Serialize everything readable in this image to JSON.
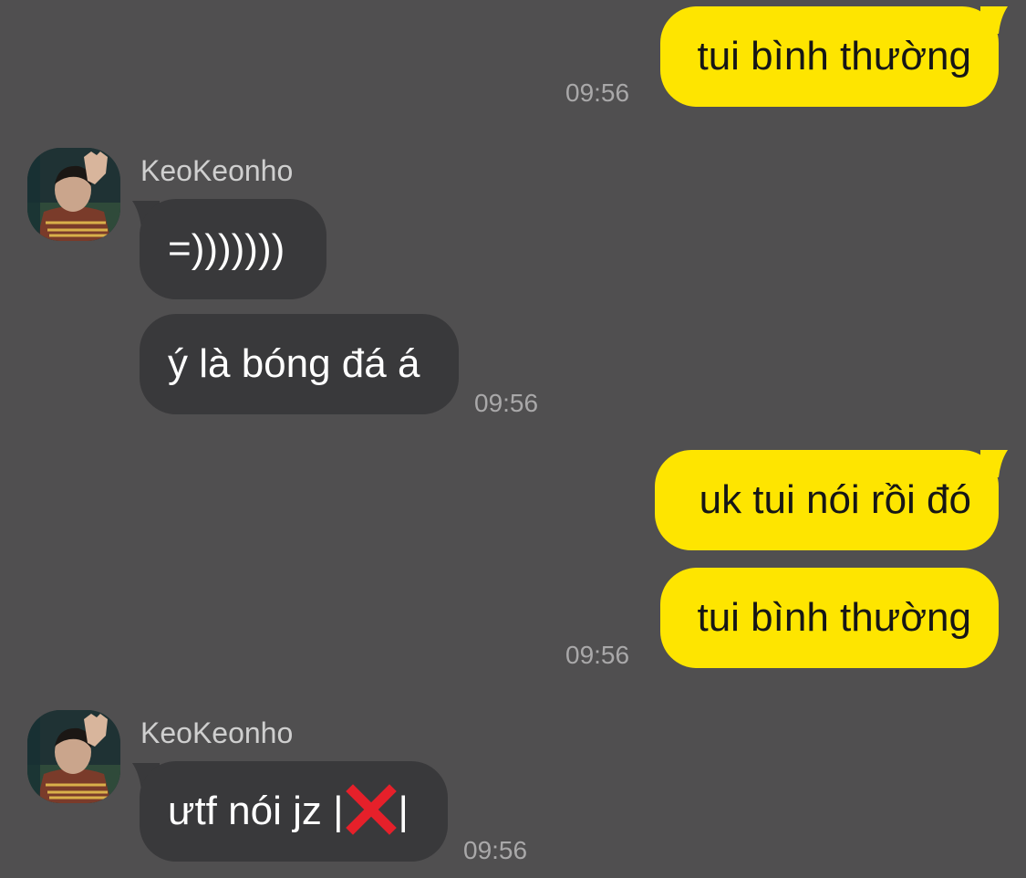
{
  "colors": {
    "background": "#504f50",
    "my_bubble": "#fee500",
    "their_bubble": "#39393b",
    "timestamp": "#a9a8a9",
    "sender_name": "#cfcfcf"
  },
  "messages": [
    {
      "id": "m1",
      "from": "me",
      "text": "tui bình thường"
    },
    {
      "id": "m2",
      "from": "KeoKeonho",
      "text": "=)))))))"
    },
    {
      "id": "m3",
      "from": "KeoKeonho",
      "text": "ý là bóng đá á"
    },
    {
      "id": "m4",
      "from": "me",
      "text": "uk tui nói rồi đó"
    },
    {
      "id": "m5",
      "from": "me",
      "text": "tui bình thường"
    },
    {
      "id": "m6",
      "from": "KeoKeonho",
      "text_before": "ưtf nói jz |",
      "icon": "red-cross-mark-emoji",
      "text_after": "|"
    }
  ],
  "groups": {
    "g1": {
      "time": "09:56"
    },
    "g2": {
      "sender": "KeoKeonho",
      "time": "09:56"
    },
    "g3": {
      "time": "09:56"
    },
    "g4": {
      "sender": "KeoKeonho",
      "time": "09:56"
    }
  }
}
